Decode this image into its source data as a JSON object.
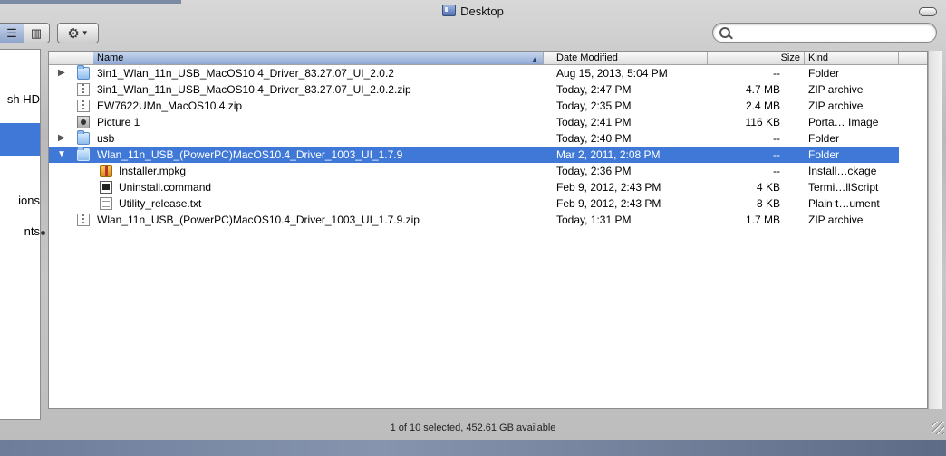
{
  "window": {
    "title": "Desktop"
  },
  "toolbar": {
    "view_list_icon": "list-view-icon",
    "view_column_icon": "column-view-icon",
    "action_icon": "gear-icon",
    "search_placeholder": ""
  },
  "sidebar": {
    "items": [
      {
        "label": "sh HD"
      },
      {
        "label": "ions"
      },
      {
        "label": "nts"
      }
    ]
  },
  "columns": {
    "name": "Name",
    "date": "Date Modified",
    "size": "Size",
    "kind": "Kind"
  },
  "files": [
    {
      "name": "3in1_Wlan_11n_USB_MacOS10.4_Driver_83.27.07_UI_2.0.2",
      "date": "Aug 15, 2013, 5:04 PM",
      "size": "--",
      "kind": "Folder"
    },
    {
      "name": "3in1_Wlan_11n_USB_MacOS10.4_Driver_83.27.07_UI_2.0.2.zip",
      "date": "Today, 2:47 PM",
      "size": "4.7 MB",
      "kind": "ZIP archive"
    },
    {
      "name": "EW7622UMn_MacOS10.4.zip",
      "date": "Today, 2:35 PM",
      "size": "2.4 MB",
      "kind": "ZIP archive"
    },
    {
      "name": "Picture 1",
      "date": "Today, 2:41 PM",
      "size": "116 KB",
      "kind": "Porta… Image"
    },
    {
      "name": "usb",
      "date": "Today, 2:40 PM",
      "size": "--",
      "kind": "Folder"
    },
    {
      "name": "Wlan_11n_USB_(PowerPC)MacOS10.4_Driver_1003_UI_1.7.9",
      "date": "Mar 2, 2011, 2:08 PM",
      "size": "--",
      "kind": "Folder"
    },
    {
      "name": "Installer.mpkg",
      "date": "Today, 2:36 PM",
      "size": "--",
      "kind": "Install…ckage"
    },
    {
      "name": "Uninstall.command",
      "date": "Feb 9, 2012, 2:43 PM",
      "size": "4 KB",
      "kind": "Termi…llScript"
    },
    {
      "name": "Utility_release.txt",
      "date": "Feb 9, 2012, 2:43 PM",
      "size": "8 KB",
      "kind": "Plain t…ument"
    },
    {
      "name": "Wlan_11n_USB_(PowerPC)MacOS10.4_Driver_1003_UI_1.7.9.zip",
      "date": "Today, 1:31 PM",
      "size": "1.7 MB",
      "kind": "ZIP archive"
    }
  ],
  "status": {
    "text": "1 of 10 selected, 452.61 GB available"
  }
}
